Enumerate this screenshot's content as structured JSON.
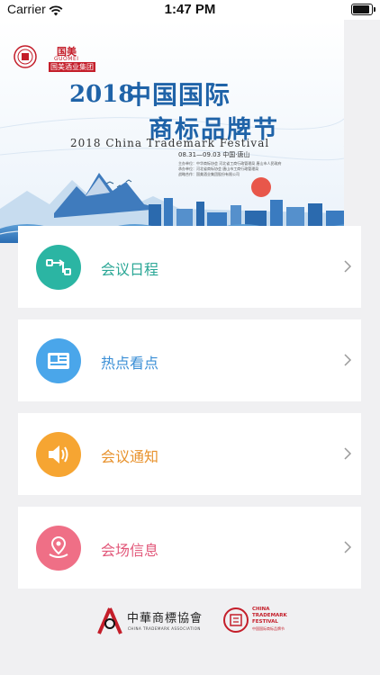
{
  "status_bar": {
    "carrier": "Carrier",
    "time": "1:47 PM",
    "battery_level": 1.0
  },
  "banner": {
    "logo_guomei_cn": "国美",
    "logo_guomei_en": "GUOMEI",
    "logo_guomei_group": "国美酒业集团",
    "year": "2018",
    "title_line1": "中国国际",
    "title_line2": "商标品牌节",
    "title_en": "2018 China Trademark Festival",
    "date": "08.31—09.03 中国·唐山",
    "credit_lines": [
      "主办单位：中华商标协会  河北省工商行政管理局  唐山市人民政府",
      "承办单位：河北省商标协会  唐山市工商行政管理局",
      "战略合作：国美酒业集团股份有限公司"
    ]
  },
  "menu": [
    {
      "label": "会议日程",
      "color": "#2bb5a3",
      "text_color": "#2ba796",
      "icon": "schedule-flow-icon"
    },
    {
      "label": "热点看点",
      "color": "#4aa6ea",
      "text_color": "#3b8fd6",
      "icon": "newspaper-icon"
    },
    {
      "label": "会议通知",
      "color": "#f6a532",
      "text_color": "#e8922d",
      "icon": "speaker-icon"
    },
    {
      "label": "会场信息",
      "color": "#ef6f86",
      "text_color": "#e2587a",
      "icon": "location-pin-icon"
    }
  ],
  "footer": {
    "association_cn": "中華商標協會",
    "association_en": "CHINA TRADEMARK ASSOCIATION",
    "festival_en_1": "CHINA",
    "festival_en_2": "TRADEMARK",
    "festival_en_3": "FESTIVAL",
    "festival_cn": "中国国际商标品牌节"
  }
}
